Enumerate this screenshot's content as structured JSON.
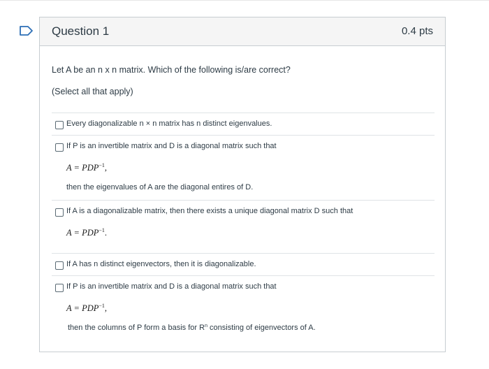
{
  "question": {
    "title": "Question 1",
    "points": "0.4 pts",
    "prompt": "Let A be an n x n matrix.  Which of the following is/are correct?",
    "hint": "(Select all that apply)"
  },
  "answers": [
    {
      "text": "Every diagonalizable n × n matrix has n distinct eigenvalues."
    },
    {
      "text": "If P is an invertible matrix and D is a diagonal matrix such that",
      "math_lhs": "A = PDP",
      "math_exp": "−1",
      "math_punct": ",",
      "follow": "then the eigenvalues of A are the diagonal entires of D."
    },
    {
      "text": "If A is a diagonalizable matrix, then there exists a unique diagonal matrix D such that",
      "math_lhs": "A = PDP",
      "math_exp": "−1",
      "math_punct": "."
    },
    {
      "text": "If A has n distinct eigenvectors, then it is diagonalizable."
    },
    {
      "text": "If P is an invertible matrix and D is a diagonal matrix such that",
      "math_lhs": "A = PDP",
      "math_exp": "−1",
      "math_punct": ",",
      "follow_pre": "then the columns of P form a basis for R",
      "follow_sup": "n",
      "follow_post": " consisting of eigenvectors of A."
    }
  ],
  "colors": {
    "flag": "#2d6fb6",
    "border": "#c7cdd1",
    "header_bg": "#f5f5f5",
    "text": "#2d3b45"
  }
}
